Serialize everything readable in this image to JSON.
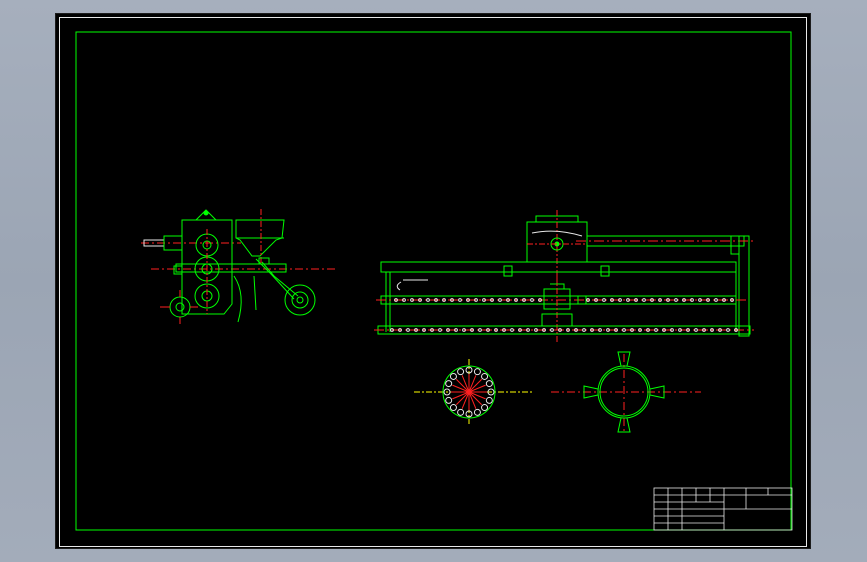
{
  "drawing": {
    "colors": {
      "background": "#000000",
      "frame": "#00ff00",
      "part": "#00ff00",
      "center_line": "#ff2020",
      "hatch": "#ffff00",
      "text": "#e8e8e8"
    },
    "view_labels": {
      "wheel_view": "",
      "cross_section": ""
    },
    "title_block": {
      "row1": [
        "",
        "",
        "",
        "",
        "",
        ""
      ],
      "row2": [
        "",
        ""
      ],
      "row3": [
        "",
        ""
      ],
      "drawing_name": ""
    }
  }
}
